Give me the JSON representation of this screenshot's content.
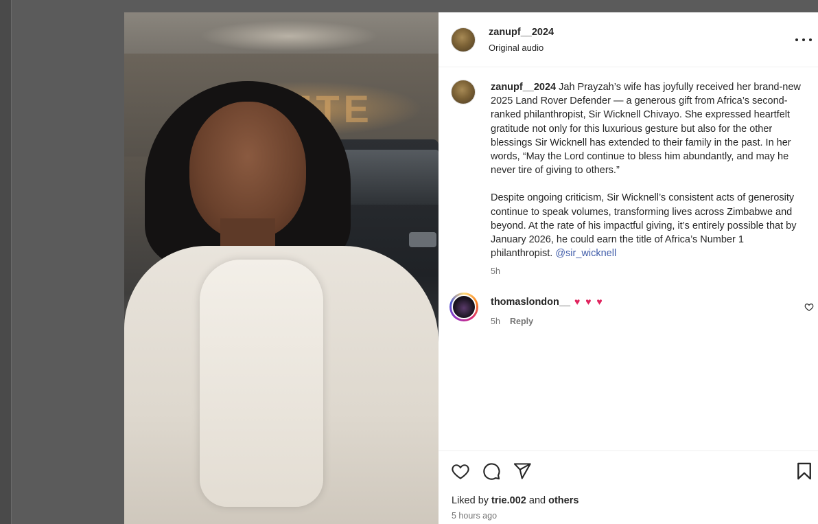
{
  "post": {
    "username": "zanupf__2024",
    "audio": "Original audio",
    "more_icon": "more-horizontal-icon"
  },
  "media": {
    "sign_text": "QUETE"
  },
  "caption": {
    "username": "zanupf__2024",
    "paragraph1": "Jah Prayzah’s wife has joyfully received her brand-new 2025 Land Rover Defender — a generous gift from Africa’s second-ranked philanthropist, Sir Wicknell Chivayo. She expressed heartfelt gratitude not only for this luxurious gesture but also for the other blessings Sir Wicknell has extended to their family in the past. In her words, “May the Lord continue to bless him abundantly, and may he never tire of giving to others.”",
    "paragraph2": "Despite ongoing criticism, Sir Wicknell’s consistent acts of generosity continue to speak volumes, transforming lives across Zimbabwe and beyond. At the rate of his impactful giving, it’s entirely possible that by January 2026, he could earn the title of Africa’s Number 1 philanthropist.",
    "mention": "@sir_wicknell",
    "time": "5h"
  },
  "comments": [
    {
      "username": "thomaslondon__",
      "text": "♥ ♥ ♥",
      "time": "5h",
      "reply_label": "Reply"
    }
  ],
  "actions": {
    "icons": [
      "heart-icon",
      "comment-icon",
      "share-icon",
      "bookmark-icon"
    ]
  },
  "likes": {
    "prefix": "Liked by",
    "user": "trie.002",
    "middle": "and",
    "others": "others"
  },
  "timestamp": "5 hours ago",
  "colors": {
    "mention": "#3d5aa8",
    "secondary_text": "#737373",
    "heart_emoji": "#e0245e"
  }
}
